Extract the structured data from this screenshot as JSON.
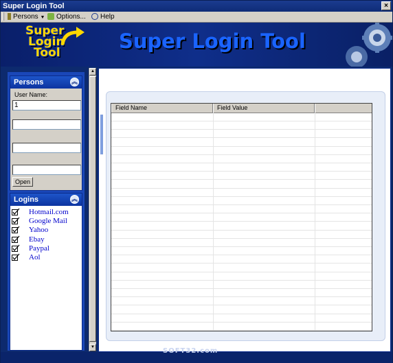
{
  "window": {
    "title": "Super Login Tool"
  },
  "menu": {
    "items": [
      {
        "label": "Persons"
      },
      {
        "label": "Options..."
      },
      {
        "label": "Help"
      }
    ]
  },
  "header": {
    "logo_lines": [
      "Super",
      "Login",
      "Tool"
    ],
    "title": "Super Login Tool"
  },
  "persons": {
    "title": "Persons",
    "user_name_label": "User Name:",
    "fields": [
      "1",
      "",
      "",
      ""
    ],
    "open_label": "Open"
  },
  "logins": {
    "title": "Logins",
    "items": [
      "Hotmail.com",
      "Google Mail",
      "Yahoo",
      "Ebay",
      "Paypal",
      "Aol"
    ]
  },
  "grid": {
    "columns": [
      "Field Name",
      "Field Value",
      ""
    ],
    "row_count": 26
  },
  "watermark": "SOFT32.com",
  "colors": {
    "accent": "#1a64ff",
    "logo": "#ffd800",
    "link": "#0000cc",
    "panel": "#1a47b8"
  }
}
